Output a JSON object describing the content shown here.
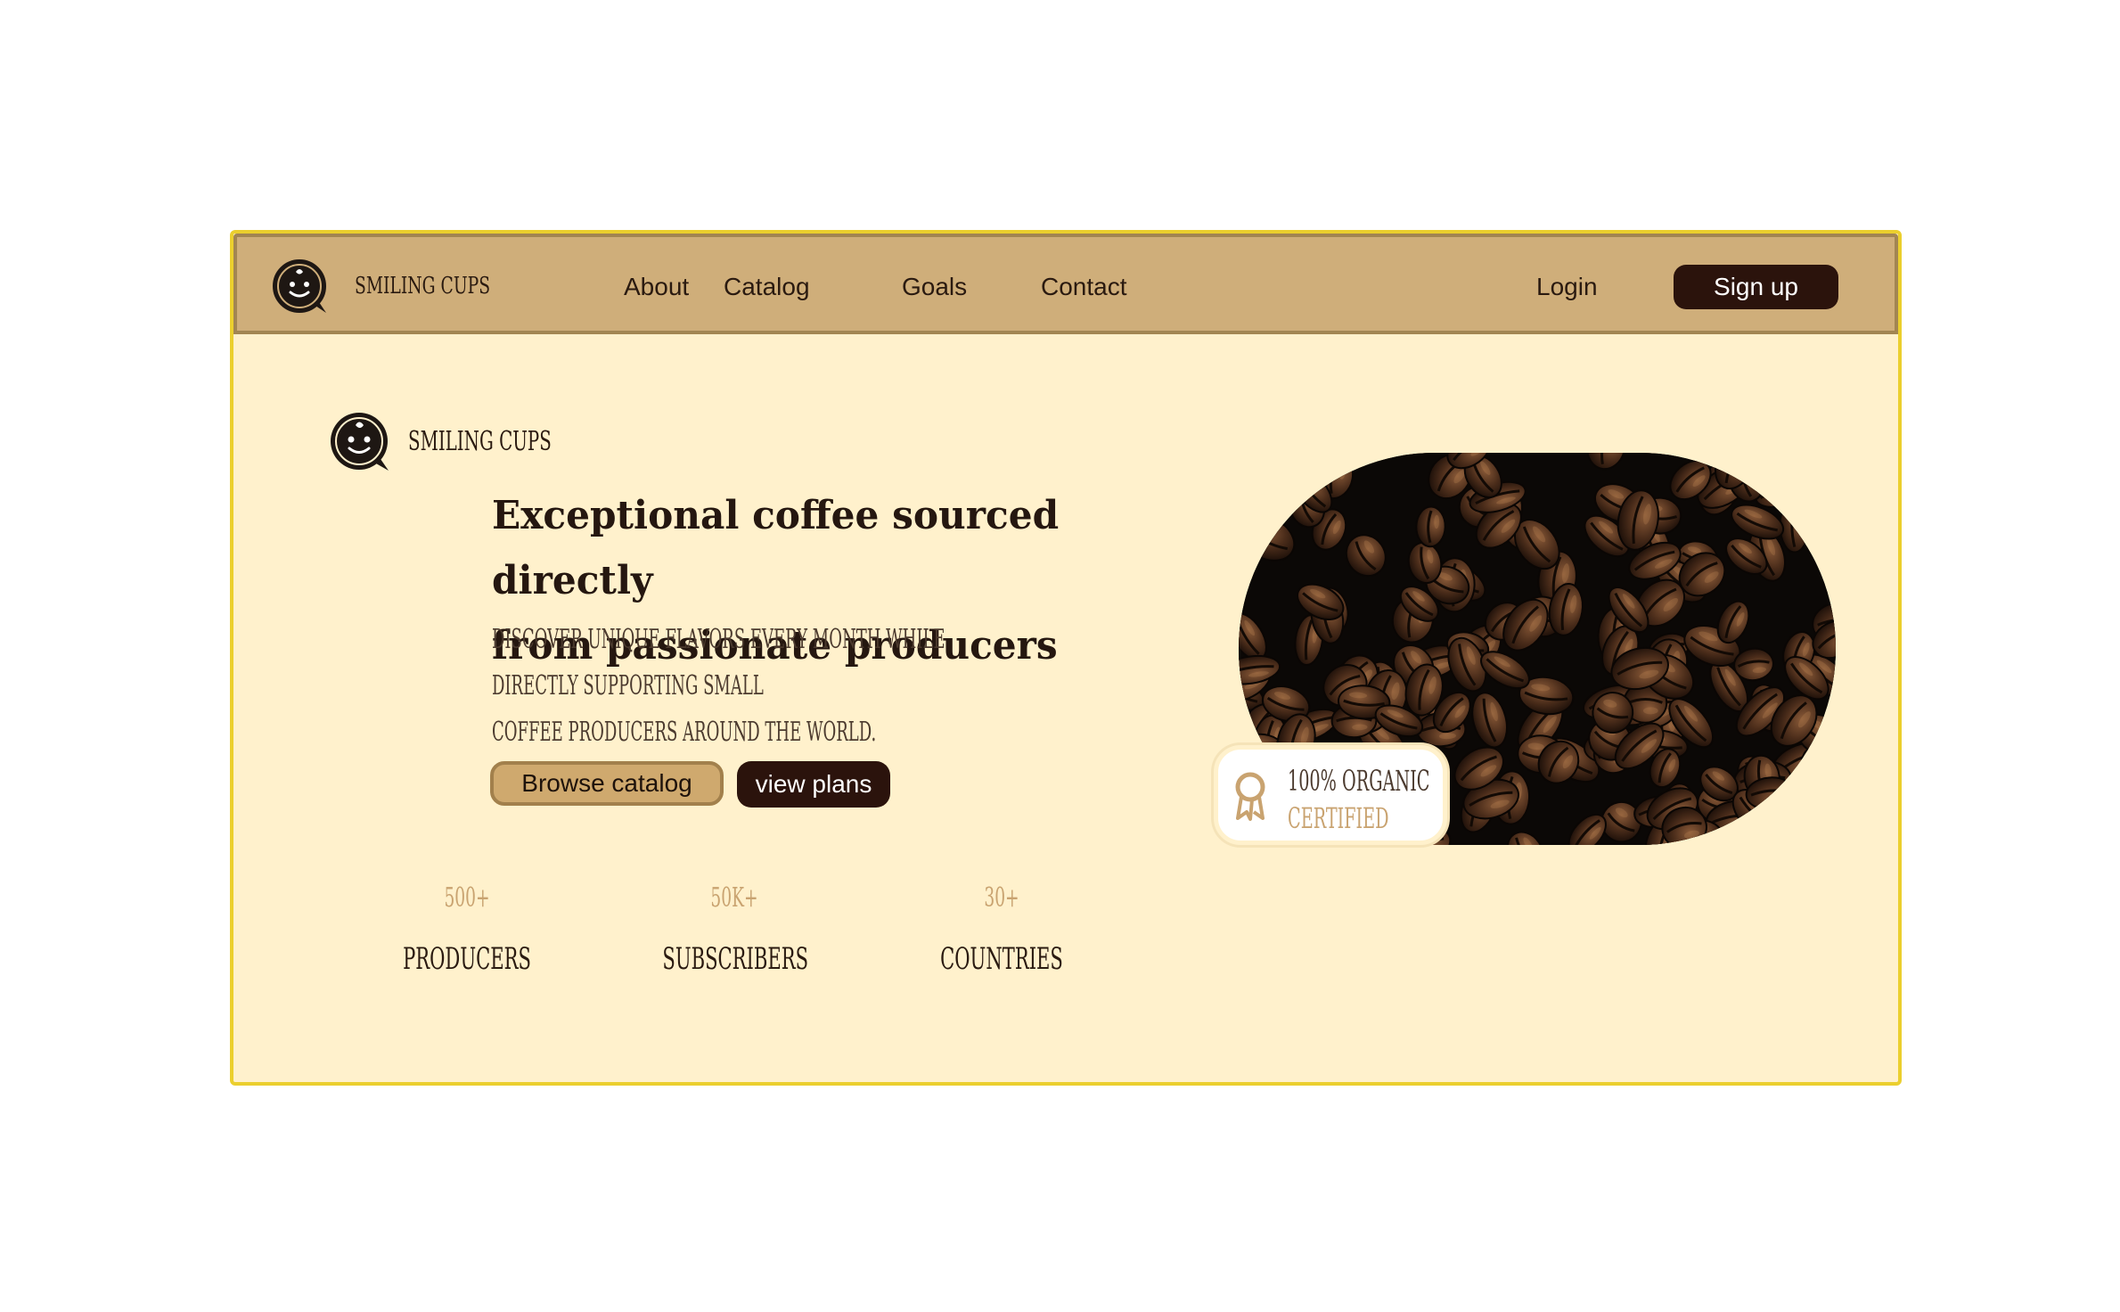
{
  "colors": {
    "navbar_bg": "#cfae7a",
    "hero_bg": "#fff1cc",
    "frame_border": "#ebcf2e",
    "dark_brown": "#2b130c",
    "accent_gold": "#c9a370"
  },
  "navbar": {
    "brand": "Smiling cups",
    "brand_icon": "smiling-cup-icon",
    "links": [
      "About",
      "Catalog",
      "Goals",
      "Contact"
    ],
    "login_label": "Login",
    "signup_label": "Sign up"
  },
  "hero": {
    "brand": "Smiling cups",
    "brand_icon": "smiling-cup-icon",
    "headline_line1": "Exceptional coffee sourced directly",
    "headline_line2": "from passionate producers",
    "subhead_line1": "Discover unique flavors every month while directly supporting small",
    "subhead_line2": "coffee producers around the world.",
    "browse_label": "Browse catalog",
    "plans_label": "view plans",
    "image": "coffee-beans-photo"
  },
  "badge": {
    "icon": "award-ribbon-icon",
    "title": "100% organic",
    "subtitle": "Certified"
  },
  "stats": [
    {
      "value": "500+",
      "label": "Producers"
    },
    {
      "value": "50K+",
      "label": "Subscribers"
    },
    {
      "value": "30+",
      "label": "Countries"
    }
  ]
}
